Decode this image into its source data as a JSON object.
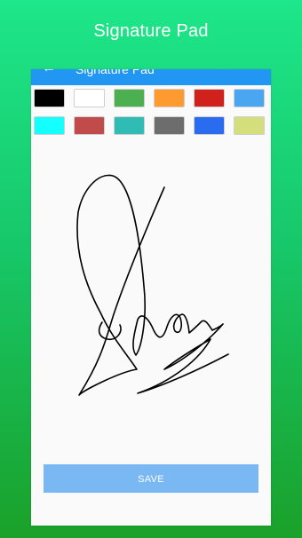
{
  "promo": {
    "title": "Signature Pad"
  },
  "app_bar": {
    "title": "Signature Pad",
    "color": "#2196f3"
  },
  "palette": {
    "colors": [
      "#000000",
      "#ffffff",
      "#4caf50",
      "#ff9a2e",
      "#d0211c",
      "#4aa6f0",
      "#14ffff",
      "#c14a4a",
      "#2fbcb5",
      "#6d6d6d",
      "#2a6cf0",
      "#d4df7c"
    ]
  },
  "signature": {
    "ink_color": "#000000"
  },
  "actions": {
    "save_label": "SAVE"
  },
  "background": {
    "gradient_top": "#1ee68a",
    "gradient_bottom": "#1aa12a"
  }
}
